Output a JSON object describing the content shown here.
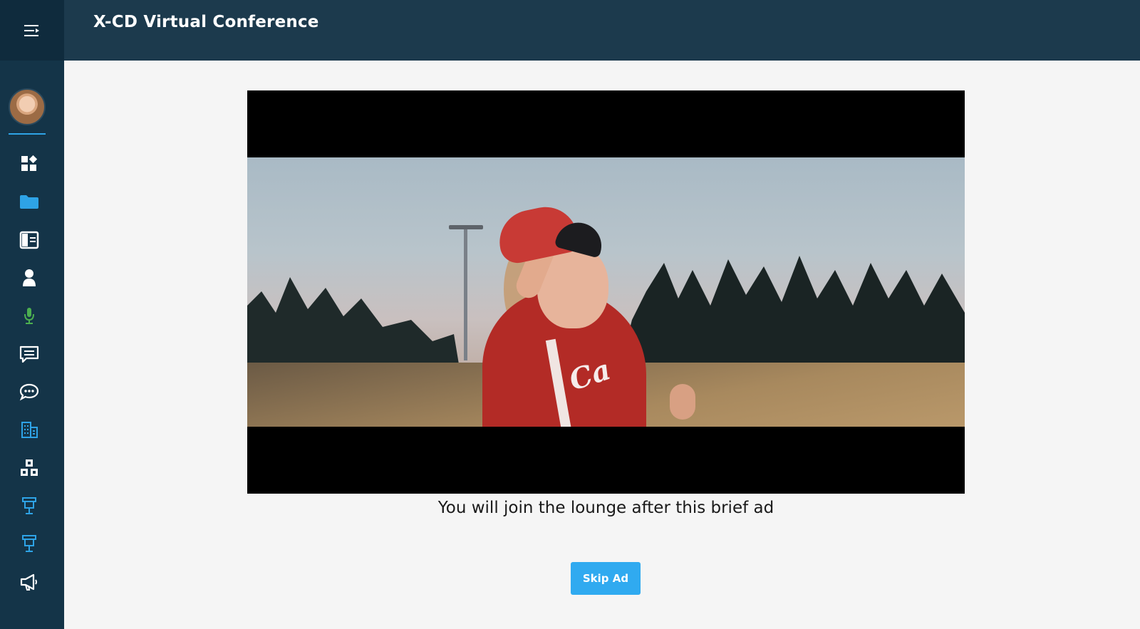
{
  "header": {
    "title": "X-CD Virtual Conference"
  },
  "sidebar": {
    "items": [
      {
        "name": "dashboard",
        "icon": "grid-icon",
        "color": "#ffffff"
      },
      {
        "name": "files",
        "icon": "folder-icon",
        "color": "#2ea3e6"
      },
      {
        "name": "agenda",
        "icon": "document-icon",
        "color": "#ffffff"
      },
      {
        "name": "profile",
        "icon": "person-icon",
        "color": "#ffffff"
      },
      {
        "name": "speakers",
        "icon": "microphone-icon",
        "color": "#4caf50"
      },
      {
        "name": "messages",
        "icon": "message-icon",
        "color": "#ffffff"
      },
      {
        "name": "chat",
        "icon": "chat-bubble-icon",
        "color": "#ffffff"
      },
      {
        "name": "exhibitors",
        "icon": "building-icon",
        "color": "#2ea3e6"
      },
      {
        "name": "sessions",
        "icon": "abc-blocks-icon",
        "color": "#ffffff"
      },
      {
        "name": "booth-1",
        "icon": "booth-icon",
        "color": "#2ea3e6"
      },
      {
        "name": "booth-2",
        "icon": "booth-icon",
        "color": "#2ea3e6"
      },
      {
        "name": "announcements",
        "icon": "megaphone-icon",
        "color": "#ffffff"
      }
    ]
  },
  "main": {
    "caption": "You will join the lounge after this brief ad",
    "skip_label": "Skip Ad",
    "jersey_text": "Ca"
  },
  "colors": {
    "sidebar": "#143448",
    "header": "#1c3a4d",
    "accent": "#30aaf0"
  }
}
